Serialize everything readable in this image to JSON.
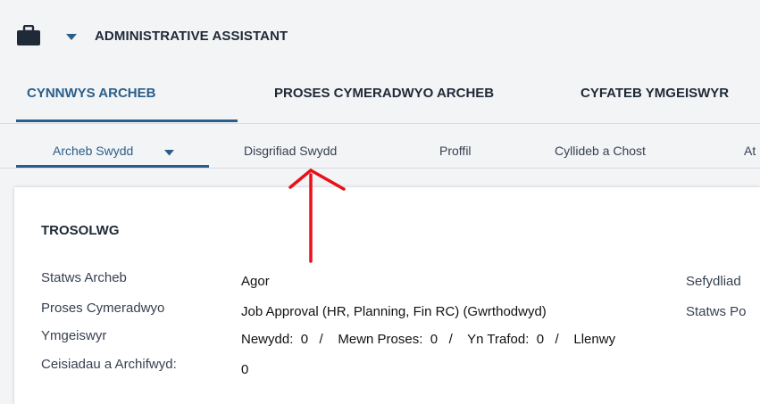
{
  "header": {
    "icon": "briefcase-icon",
    "dropdown_icon": "caret-down-icon",
    "title": "ADMINISTRATIVE ASSISTANT"
  },
  "tabs": [
    {
      "label": "CYNNWYS ARCHEB",
      "active": true
    },
    {
      "label": "PROSES CYMERADWYO ARCHEB",
      "active": false
    },
    {
      "label": "CYFATEB YMGEISWYR",
      "active": false
    }
  ],
  "subtabs": [
    {
      "label": "Archeb Swydd",
      "active": true
    },
    {
      "label": "Disgrifiad Swydd",
      "active": false
    },
    {
      "label": "Proffil",
      "active": false
    },
    {
      "label": "Cyllideb a Chost",
      "active": false
    },
    {
      "label": "At",
      "active": false
    }
  ],
  "overview": {
    "title": "TROSOLWG",
    "rows": [
      {
        "label": "Statws Archeb",
        "value": "Agor"
      },
      {
        "label": "Proses Cymeradwyo",
        "value": "Job Approval (HR, Planning, Fin RC) (Gwrthodwyd)"
      },
      {
        "label": "Ymgeiswyr",
        "value": "Newydd:  0   /    Mewn Proses:  0   /    Yn Trafod:  0   /    Llenwy"
      },
      {
        "label": "Ceisiadau a Archifwyd:",
        "value": "0"
      }
    ],
    "right_labels": [
      "Sefydliad",
      "Statws Po"
    ]
  },
  "annotation": {
    "color": "#e8101a",
    "icon": "red-arrow-annotation"
  },
  "colors": {
    "accent": "#2a5e8a",
    "background": "#f3f4f6"
  }
}
